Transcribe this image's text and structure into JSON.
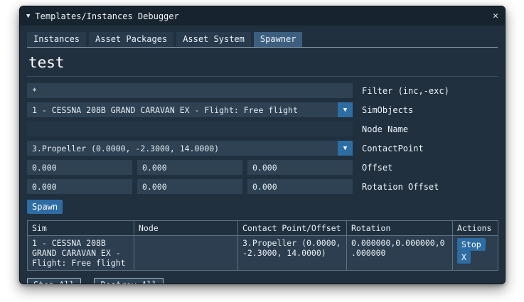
{
  "window": {
    "title": "Templates/Instances Debugger",
    "collapse_icon": "▼",
    "close_icon": "✕"
  },
  "tabs": [
    {
      "label": "Instances"
    },
    {
      "label": "Asset Packages"
    },
    {
      "label": "Asset System"
    },
    {
      "label": "Spawner"
    }
  ],
  "spawner": {
    "heading": "test",
    "filter": {
      "value": "*",
      "label": "Filter (inc,-exc)"
    },
    "simobjects": {
      "value": "1 - CESSNA 208B GRAND CARAVAN EX - Flight: Free flight",
      "label": "SimObjects",
      "arrow": "▼"
    },
    "node_name": {
      "value": "",
      "label": "Node Name"
    },
    "contact_point": {
      "value": "3.Propeller (0.0000, -2.3000, 14.0000)",
      "label": "ContactPoint",
      "arrow": "▼"
    },
    "offset": {
      "values": [
        "0.000",
        "0.000",
        "0.000"
      ],
      "label": "Offset"
    },
    "rotation_offset": {
      "values": [
        "0.000",
        "0.000",
        "0.000"
      ],
      "label": "Rotation Offset"
    },
    "spawn_button": "Spawn"
  },
  "table": {
    "headers": [
      "Sim",
      "Node",
      "Contact Point/Offset",
      "Rotation",
      "Actions"
    ],
    "rows": [
      {
        "sim": "1 - CESSNA 208B GRAND CARAVAN EX - Flight: Free flight",
        "node": "",
        "contact": "3.Propeller (0.0000, -2.3000, 14.0000)",
        "rotation": "0.000000,0.000000,0.000000",
        "stop_label": "Stop",
        "remove_label": "X"
      }
    ]
  },
  "footer": {
    "stop_all": "Stop All",
    "destroy_all": "Destroy All"
  },
  "colors": {
    "window_bg": "#20303f",
    "titlebar_bg": "#17232e",
    "field_bg": "#2e4254",
    "accent_button": "#2e6ca4",
    "active_tab": "#3c5f80"
  }
}
